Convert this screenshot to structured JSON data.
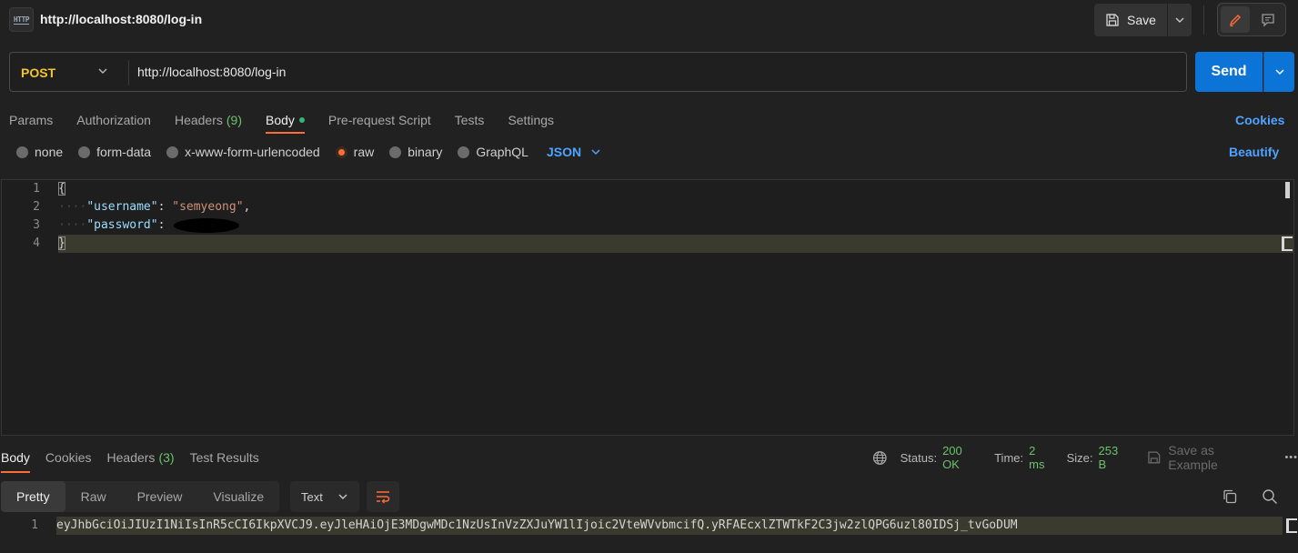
{
  "header": {
    "title": "http://localhost:8080/log-in",
    "icon_text": "HTTP",
    "save_label": "Save"
  },
  "request": {
    "method": "POST",
    "url": "http://localhost:8080/log-in",
    "send_label": "Send"
  },
  "tabs": [
    {
      "label": "Params"
    },
    {
      "label": "Authorization"
    },
    {
      "label": "Headers",
      "count": "(9)"
    },
    {
      "label": "Body"
    },
    {
      "label": "Pre-request Script"
    },
    {
      "label": "Tests"
    },
    {
      "label": "Settings"
    }
  ],
  "cookies_label": "Cookies",
  "body_types": [
    "none",
    "form-data",
    "x-www-form-urlencoded",
    "raw",
    "binary",
    "GraphQL"
  ],
  "body_format": "JSON",
  "beautify_label": "Beautify",
  "editor": {
    "line_numbers": [
      "1",
      "2",
      "3",
      "4"
    ],
    "open_brace": "{",
    "close_brace": "}",
    "ws_marker": "····",
    "username_key": "\"username\"",
    "username_value": "\"semyeong\"",
    "password_key": "\"password\"",
    "colon": ":",
    "comma": ","
  },
  "response": {
    "tabs": [
      {
        "label": "Body"
      },
      {
        "label": "Cookies"
      },
      {
        "label": "Headers",
        "count": "(3)"
      },
      {
        "label": "Test Results"
      }
    ],
    "status_label": "Status:",
    "status_value": "200 OK",
    "time_label": "Time:",
    "time_value": "2 ms",
    "size_label": "Size:",
    "size_value": "253 B",
    "save_example_label": "Save as Example",
    "more_label": "•••",
    "views": [
      "Pretty",
      "Raw",
      "Preview",
      "Visualize"
    ],
    "format": "Text",
    "line_number": "1",
    "body_text": "eyJhbGciOiJIUzI1NiIsInR5cCI6IkpXVCJ9.eyJleHAiOjE3MDgwMDc1NzUsInVzZXJuYW1lIjoic2VteWVvbmcifQ.yRFAEcxlZTWTkF2C3jw2zlQPG6uzl80IDSj_tvGoDUM"
  },
  "colors": {
    "accent_orange": "#ff6c37",
    "send_blue": "#0c74d6",
    "link_blue": "#4da3ff",
    "method_yellow": "#f4c430",
    "status_green": "#6cc26a"
  },
  "icons": [
    "http-icon",
    "save-icon",
    "chevron-down-icon",
    "pencil-icon",
    "comment-icon",
    "globe-icon",
    "copy-icon",
    "search-icon",
    "wrap-lines-icon"
  ]
}
